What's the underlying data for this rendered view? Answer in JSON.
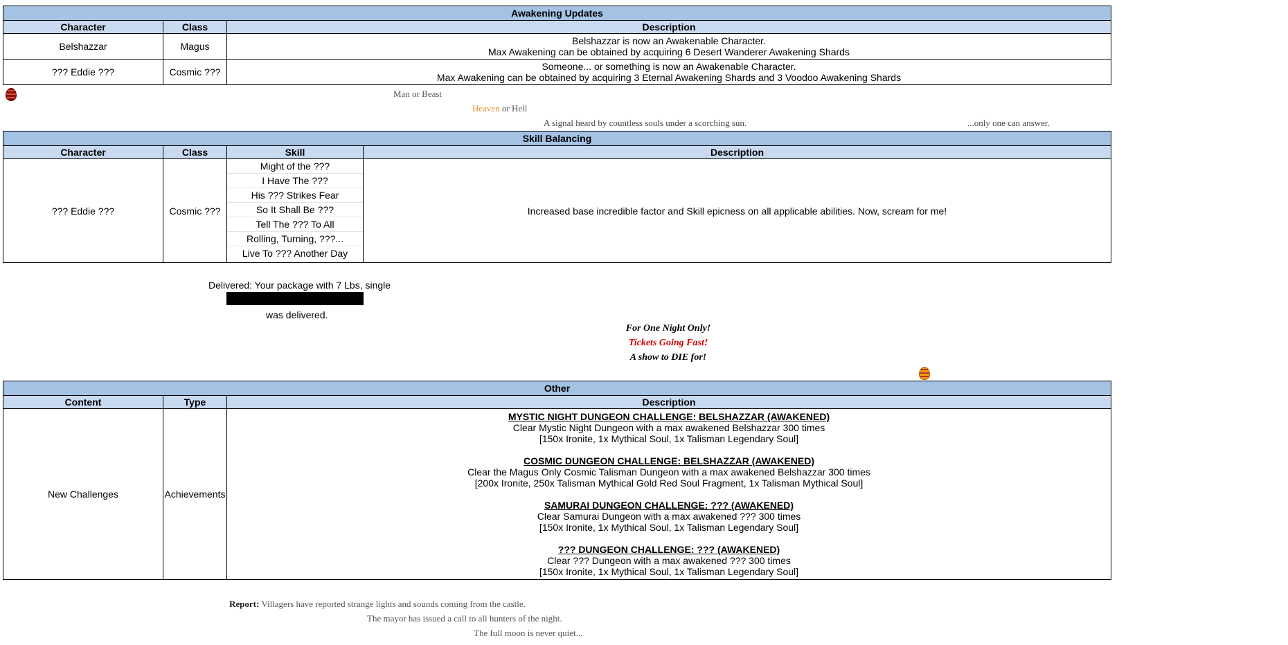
{
  "awakening": {
    "title": "Awakening Updates",
    "headers": [
      "Character",
      "Class",
      "Description"
    ],
    "rows": [
      {
        "character": "Belshazzar",
        "class": "Magus",
        "desc1": "Belshazzar is now an Awakenable Character.",
        "desc2": "Max Awakening can be obtained by acquiring 6 Desert Wanderer Awakening Shards"
      },
      {
        "character": "??? Eddie ???",
        "class": "Cosmic ???",
        "desc1": "Someone... or something is now an Awakenable Character.",
        "desc2": "Max Awakening can be obtained by acquiring 3 Eternal Awakening Shards and 3 Voodoo Awakening Shards"
      }
    ]
  },
  "lore1": {
    "man_or_beast": "Man or Beast",
    "heaven": "Heaven",
    "or_hell": " or Hell",
    "signal": "A signal heard by countless souls under a scorching sun.",
    "only_one": "...only one can answer."
  },
  "skills": {
    "title": "Skill Balancing",
    "headers": [
      "Character",
      "Class",
      "Skill",
      "Description"
    ],
    "character": "??? Eddie ???",
    "class": "Cosmic ???",
    "skill_list": [
      "Might of the ???",
      "I Have The ???",
      "His ??? Strikes Fear",
      "So It Shall Be ???",
      "Tell The ??? To All",
      "Rolling, Turning, ???...",
      "Live To ??? Another Day"
    ],
    "description": "Increased base incredible factor and Skill epicness on all applicable abilities. Now, scream for me!"
  },
  "delivery": {
    "line1": "Delivered: Your package with 7 Lbs, single",
    "line2": "was delivered."
  },
  "show": {
    "line1": "For One Night Only!",
    "line2": "Tickets Going Fast!",
    "line3": "A show to DIE for!",
    "line2_color": "#cc0000"
  },
  "other": {
    "title": "Other",
    "headers": [
      "Content",
      "Type",
      "Description"
    ],
    "content": "New Challenges",
    "type": "Achievements",
    "challenges": [
      {
        "title": "MYSTIC NIGHT DUNGEON CHALLENGE: BELSHAZZAR (AWAKENED)",
        "line": "Clear Mystic Night Dungeon with a max awakened Belshazzar 300 times",
        "reward": "[150x Ironite, 1x Mythical Soul, 1x Talisman Legendary Soul]"
      },
      {
        "title": "COSMIC DUNGEON CHALLENGE: BELSHAZZAR (AWAKENED)",
        "line": "Clear the Magus Only Cosmic Talisman Dungeon with a max awakened Belshazzar 300 times",
        "reward": "[200x Ironite, 250x Talisman Mythical Gold Red Soul Fragment, 1x Talisman Mythical Soul]"
      },
      {
        "title": "SAMURAI DUNGEON CHALLENGE: ??? (AWAKENED)",
        "line": "Clear Samurai Dungeon with a max awakened ??? 300 times",
        "reward": "[150x Ironite, 1x Mythical Soul, 1x Talisman Legendary Soul]"
      },
      {
        "title": "??? DUNGEON CHALLENGE: ??? (AWAKENED)",
        "line": "Clear ??? Dungeon with a max awakened ??? 300 times",
        "reward": "[150x Ironite, 1x Mythical Soul, 1x Talisman Legendary Soul]"
      }
    ]
  },
  "report": {
    "label": "Report:",
    "line1": " Villagers have reported strange lights and sounds coming from the castle.",
    "line2": "The mayor has issued a call to all hunters of the night.",
    "line3": "The full moon is never quiet..."
  },
  "colors": {
    "title_bg": "#a4c2e4",
    "header_bg": "#c9daf0",
    "heaven": "#e69138",
    "lore_text": "#555555"
  }
}
